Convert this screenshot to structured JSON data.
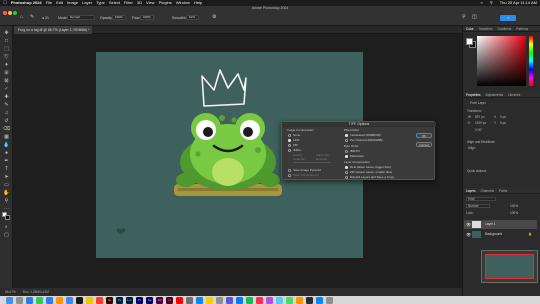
{
  "menubar": {
    "app": "Photoshop 2024",
    "items": [
      "File",
      "Edit",
      "Image",
      "Layer",
      "Type",
      "Select",
      "Filter",
      "3D",
      "View",
      "Plugins",
      "Window",
      "Help"
    ],
    "clock": "Thu 25 Apr 11:14 AM"
  },
  "window": {
    "title": "Adobe Photoshop 2024"
  },
  "options": {
    "mode_label": "Mode:",
    "mode_value": "Normal",
    "opacity_label": "Opacity:",
    "opacity_value": "100%",
    "flow_label": "Flow:",
    "flow_value": "100%",
    "smoothing_label": "Smoothing:",
    "smoothing_value": "10%"
  },
  "document": {
    "tab": "Frog on a log.tif @ 66.7% (Layer 1, RGB/8#) *",
    "zoom": "66.67%",
    "doc_size": "Doc: 1.25M/4.42M"
  },
  "dialog": {
    "title": "TIFF Options",
    "image_compression": {
      "heading": "Image Compression",
      "options": [
        "None",
        "LZW",
        "ZIP",
        "JPEG"
      ],
      "selected": "LZW",
      "quality_label": "Quality:",
      "maximum_label": "Maximum",
      "small_file": "small file",
      "large_file": "large file"
    },
    "pixel_order": {
      "heading": "Pixel Order",
      "options": [
        "Interleaved (RGBRGB)",
        "Per Channel (RRGGBB)"
      ],
      "selected": "Interleaved (RGBRGB)"
    },
    "byte_order": {
      "heading": "Byte Order",
      "options": [
        "IBM PC",
        "Macintosh"
      ],
      "selected": "Macintosh"
    },
    "save_pyramid": "Save Image Pyramid",
    "save_transparency": "Save Transparency",
    "layer_compression": {
      "heading": "Layer Compression",
      "options": [
        "RLE (faster saves, bigger files)",
        "ZIP (slower saves, smaller files)",
        "Discard Layers and Save a Copy"
      ],
      "selected": "RLE (faster saves, bigger files)"
    },
    "ok": "OK",
    "cancel": "Cancel"
  },
  "panels": {
    "color_tabs": [
      "Color",
      "Swatches",
      "Gradients",
      "Patterns"
    ],
    "properties_tabs": [
      "Properties",
      "Adjustments",
      "Libraries"
    ],
    "pixel_layer": "Pixel Layer",
    "transform": "Transform",
    "w_label": "W",
    "w_value": "897 px",
    "h_label": "H",
    "h_value": "1159 px",
    "x_label": "X",
    "x_value": "0 px",
    "y_label": "Y",
    "y_value": "0 px",
    "angle": "0.00°",
    "align": "Align and Distribute",
    "align_sub": "Align:",
    "quick_actions": "Quick Actions",
    "layers_tabs": [
      "Layers",
      "Channels",
      "Paths"
    ],
    "kind_label": "Kind",
    "blend_mode": "Normal",
    "opacity": "100%",
    "lock_label": "Lock:",
    "fill": "100%",
    "layers": [
      "Layer 1",
      "Background"
    ]
  },
  "colors": {
    "artboard": "#3e615d",
    "frog_green": "#7ac943",
    "accent": "#2d8ceb"
  }
}
